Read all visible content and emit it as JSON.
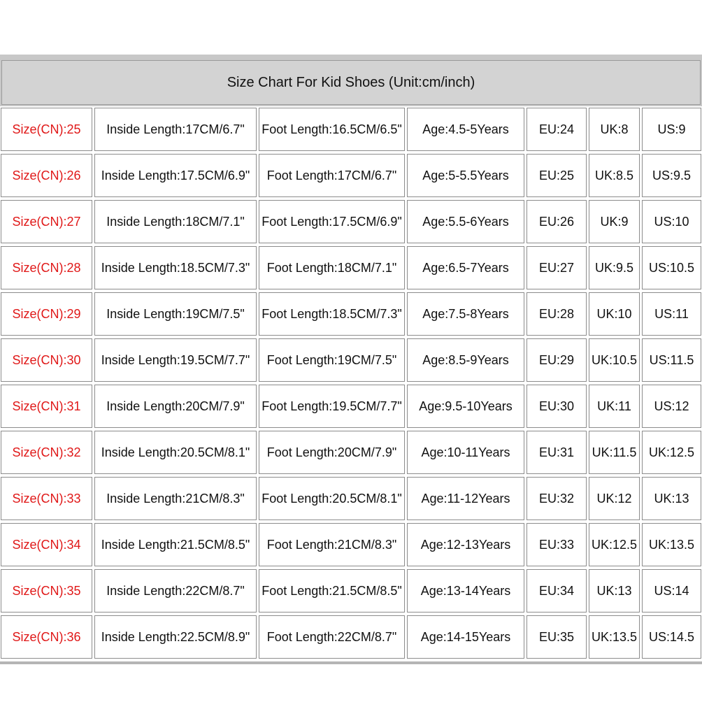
{
  "chart_data": {
    "type": "table",
    "title": "Size Chart For Kid Shoes (Unit:cm/inch)",
    "rows": [
      [
        "Size(CN):25",
        "Inside Length:17CM/6.7\"",
        "Foot Length:16.5CM/6.5\"",
        "Age:4.5-5Years",
        "EU:24",
        "UK:8",
        "US:9"
      ],
      [
        "Size(CN):26",
        "Inside Length:17.5CM/6.9\"",
        "Foot Length:17CM/6.7\"",
        "Age:5-5.5Years",
        "EU:25",
        "UK:8.5",
        "US:9.5"
      ],
      [
        "Size(CN):27",
        "Inside Length:18CM/7.1\"",
        "Foot Length:17.5CM/6.9\"",
        "Age:5.5-6Years",
        "EU:26",
        "UK:9",
        "US:10"
      ],
      [
        "Size(CN):28",
        "Inside Length:18.5CM/7.3\"",
        "Foot Length:18CM/7.1\"",
        "Age:6.5-7Years",
        "EU:27",
        "UK:9.5",
        "US:10.5"
      ],
      [
        "Size(CN):29",
        "Inside Length:19CM/7.5\"",
        "Foot Length:18.5CM/7.3\"",
        "Age:7.5-8Years",
        "EU:28",
        "UK:10",
        "US:11"
      ],
      [
        "Size(CN):30",
        "Inside Length:19.5CM/7.7\"",
        "Foot Length:19CM/7.5\"",
        "Age:8.5-9Years",
        "EU:29",
        "UK:10.5",
        "US:11.5"
      ],
      [
        "Size(CN):31",
        "Inside Length:20CM/7.9\"",
        "Foot Length:19.5CM/7.7\"",
        "Age:9.5-10Years",
        "EU:30",
        "UK:11",
        "US:12"
      ],
      [
        "Size(CN):32",
        "Inside Length:20.5CM/8.1\"",
        "Foot Length:20CM/7.9\"",
        "Age:10-11Years",
        "EU:31",
        "UK:11.5",
        "UK:12.5"
      ],
      [
        "Size(CN):33",
        "Inside Length:21CM/8.3\"",
        "Foot Length:20.5CM/8.1\"",
        "Age:11-12Years",
        "EU:32",
        "UK:12",
        "UK:13"
      ],
      [
        "Size(CN):34",
        "Inside Length:21.5CM/8.5\"",
        "Foot Length:21CM/8.3\"",
        "Age:12-13Years",
        "EU:33",
        "UK:12.5",
        "UK:13.5"
      ],
      [
        "Size(CN):35",
        "Inside Length:22CM/8.7\"",
        "Foot Length:21.5CM/8.5\"",
        "Age:13-14Years",
        "EU:34",
        "UK:13",
        "US:14"
      ],
      [
        "Size(CN):36",
        "Inside Length:22.5CM/8.9\"",
        "Foot Length:22CM/8.7\"",
        "Age:14-15Years",
        "EU:35",
        "UK:13.5",
        "US:14.5"
      ]
    ]
  },
  "colors": {
    "size_label": "#e01818",
    "title_background": "#d3d3d3",
    "border": "#8c8c8c"
  }
}
